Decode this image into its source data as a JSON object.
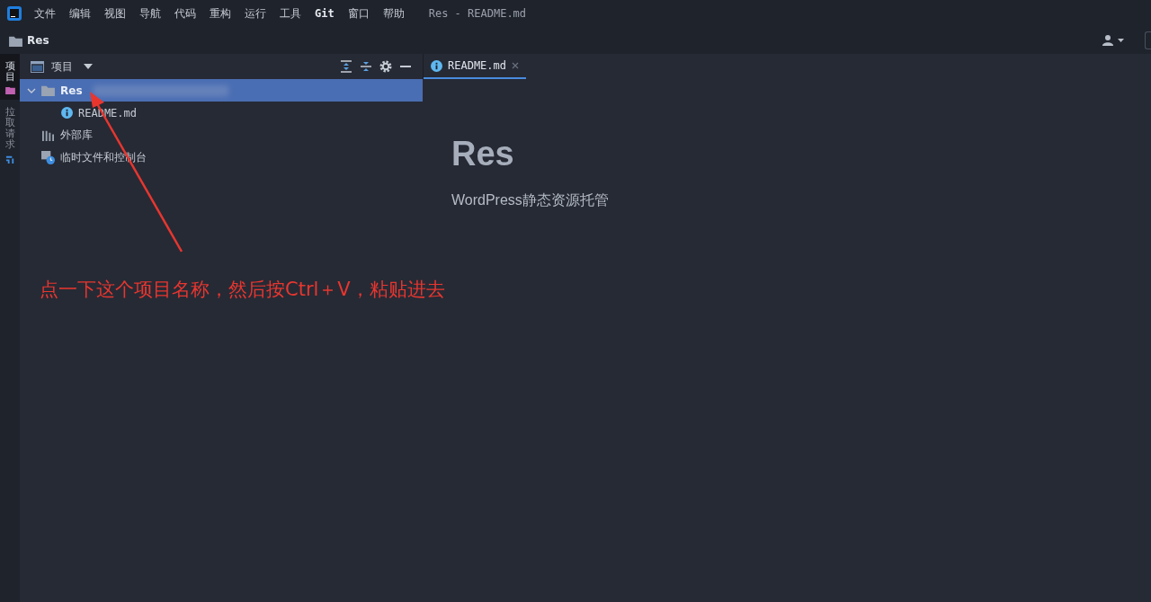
{
  "menu": [
    {
      "label": "文件",
      "bold": false
    },
    {
      "label": "编辑",
      "bold": false
    },
    {
      "label": "视图",
      "bold": false
    },
    {
      "label": "导航",
      "bold": false
    },
    {
      "label": "代码",
      "bold": false
    },
    {
      "label": "重构",
      "bold": false
    },
    {
      "label": "运行",
      "bold": false
    },
    {
      "label": "工具",
      "bold": false
    },
    {
      "label": "Git",
      "bold": true
    },
    {
      "label": "窗口",
      "bold": false
    },
    {
      "label": "帮助",
      "bold": false
    }
  ],
  "window": {
    "title": "Res - README.md"
  },
  "breadcrumb": "Res",
  "side_tabs": [
    {
      "label": "项目",
      "selected": true,
      "kind": "folder"
    },
    {
      "label": "拉取请求",
      "selected": false,
      "kind": "pull"
    }
  ],
  "project_panel": {
    "title": "项目"
  },
  "tree": [
    {
      "label": "Res",
      "kind": "folder",
      "expanded": true,
      "selected": true,
      "children": [
        {
          "label": "README.md",
          "kind": "info",
          "selected": false
        }
      ]
    },
    {
      "label": "外部库",
      "kind": "library",
      "selected": false
    },
    {
      "label": "临时文件和控制台",
      "kind": "scratch",
      "selected": false
    }
  ],
  "editor_tab": {
    "label": "README.md",
    "selected": true
  },
  "readme": {
    "heading": "Res",
    "text": "WordPress静态资源托管"
  },
  "annotation": "点一下这个项目名称，然后按Ctrl＋V，粘贴进去"
}
